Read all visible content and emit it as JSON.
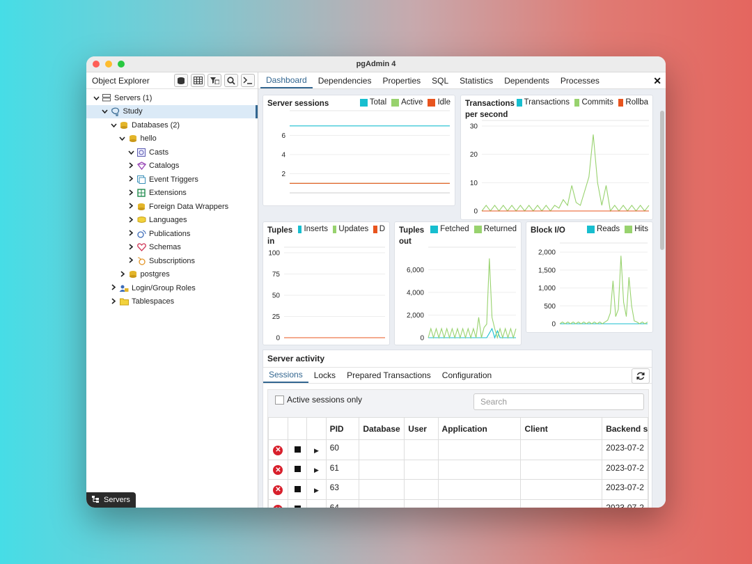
{
  "window": {
    "title": "pgAdmin 4",
    "traffic_colors": [
      "#fe5f57",
      "#febc2e",
      "#28c840"
    ]
  },
  "object_explorer": {
    "title": "Object Explorer",
    "toolbar": [
      "db-query-icon",
      "table-icon",
      "filter-table-icon",
      "search-icon",
      "terminal-icon"
    ],
    "tree": [
      {
        "label": "Servers (1)",
        "depth": 0,
        "arrow": "down",
        "icon": "servers-icon",
        "selected": false
      },
      {
        "label": "Study",
        "depth": 1,
        "arrow": "down",
        "icon": "elephant-icon",
        "selected": true
      },
      {
        "label": "Databases (2)",
        "depth": 2,
        "arrow": "down",
        "icon": "databases-icon",
        "selected": false
      },
      {
        "label": "hello",
        "depth": 3,
        "arrow": "down",
        "icon": "database-icon",
        "selected": false
      },
      {
        "label": "Casts",
        "depth": 4,
        "arrow": "down",
        "icon": "casts-icon",
        "selected": false
      },
      {
        "label": "Catalogs",
        "depth": 4,
        "arrow": "right",
        "icon": "catalogs-icon",
        "selected": false
      },
      {
        "label": "Event Triggers",
        "depth": 4,
        "arrow": "right",
        "icon": "event-triggers-icon",
        "selected": false
      },
      {
        "label": "Extensions",
        "depth": 4,
        "arrow": "right",
        "icon": "extensions-icon",
        "selected": false
      },
      {
        "label": "Foreign Data Wrappers",
        "depth": 4,
        "arrow": "right",
        "icon": "foreign-data-wrappers-icon",
        "selected": false
      },
      {
        "label": "Languages",
        "depth": 4,
        "arrow": "right",
        "icon": "languages-icon",
        "selected": false
      },
      {
        "label": "Publications",
        "depth": 4,
        "arrow": "right",
        "icon": "publications-icon",
        "selected": false
      },
      {
        "label": "Schemas",
        "depth": 4,
        "arrow": "right",
        "icon": "schemas-icon",
        "selected": false
      },
      {
        "label": "Subscriptions",
        "depth": 4,
        "arrow": "right",
        "icon": "subscriptions-icon",
        "selected": false
      },
      {
        "label": "postgres",
        "depth": 3,
        "arrow": "right",
        "icon": "database-icon",
        "selected": false
      },
      {
        "label": "Login/Group Roles",
        "depth": 2,
        "arrow": "right",
        "icon": "roles-icon",
        "selected": false
      },
      {
        "label": "Tablespaces",
        "depth": 2,
        "arrow": "right",
        "icon": "tablespaces-icon",
        "selected": false
      }
    ],
    "status_label": "Servers"
  },
  "tabs": [
    "Dashboard",
    "Dependencies",
    "Properties",
    "SQL",
    "Statistics",
    "Dependents",
    "Processes"
  ],
  "active_tab": "Dashboard",
  "colors": {
    "cyan": "#17becf",
    "green": "#98d26e",
    "orange": "#e8541e",
    "accent": "#326690"
  },
  "chart_data": [
    {
      "type": "line",
      "title": "Server sessions",
      "series": [
        {
          "name": "Total",
          "color": "#17becf",
          "values": [
            7,
            7,
            7,
            7,
            7,
            7,
            7,
            7,
            7,
            7,
            7,
            7,
            7,
            7,
            7,
            7,
            7,
            7,
            7,
            7,
            7,
            7,
            7,
            7,
            7,
            7,
            7,
            7,
            7,
            7
          ]
        },
        {
          "name": "Active",
          "color": "#98d26e",
          "values": [
            1,
            1,
            1,
            1,
            1,
            1,
            1,
            1,
            1,
            1,
            1,
            1,
            1,
            1,
            1,
            1,
            1,
            1,
            1,
            1,
            1,
            1,
            1,
            1,
            1,
            1,
            1,
            1,
            1,
            1
          ]
        },
        {
          "name": "Idle",
          "color": "#e8541e",
          "values": [
            1,
            1,
            1,
            1,
            1,
            1,
            1,
            1,
            1,
            1,
            1,
            1,
            1,
            1,
            1,
            1,
            1,
            1,
            1,
            1,
            1,
            1,
            1,
            1,
            1,
            1,
            1,
            1,
            1,
            1
          ]
        }
      ],
      "yticks": [
        "2",
        "4",
        "6"
      ],
      "ylim": [
        0,
        8
      ]
    },
    {
      "type": "line",
      "title": "Transactions per second",
      "title_lines": [
        "Transactions",
        "per second"
      ],
      "series": [
        {
          "name": "Transactions",
          "color": "#17becf",
          "values": []
        },
        {
          "name": "Commits",
          "color": "#98d26e",
          "values": [
            0,
            2,
            0,
            2,
            0,
            2,
            0,
            2,
            0,
            2,
            0,
            2,
            0,
            2,
            0,
            2,
            0,
            2,
            1,
            4,
            2,
            9,
            3,
            2,
            7,
            12,
            27,
            10,
            2,
            9,
            0,
            2,
            0,
            2,
            0,
            2,
            0,
            2,
            0,
            2
          ]
        },
        {
          "name": "Rollba",
          "color": "#e8541e",
          "values": [
            0,
            0,
            0,
            0,
            0,
            0,
            0,
            0,
            0,
            0,
            0,
            0,
            0,
            0,
            0,
            0,
            0,
            0,
            0,
            0,
            0,
            0,
            0,
            0,
            0,
            0,
            0,
            0,
            0,
            0,
            0,
            0,
            0,
            0,
            0,
            0,
            0,
            0,
            0,
            0
          ]
        }
      ],
      "yticks": [
        "0",
        "10",
        "20",
        "30"
      ],
      "ylim": [
        0,
        30
      ]
    },
    {
      "type": "line",
      "title": "Tuples in",
      "title_lines": [
        "Tuples",
        "in"
      ],
      "series": [
        {
          "name": "Inserts",
          "color": "#17becf",
          "values": []
        },
        {
          "name": "Updates",
          "color": "#98d26e",
          "values": []
        },
        {
          "name": "D",
          "color": "#e8541e",
          "values": [
            0,
            0,
            0,
            0,
            0,
            0,
            0,
            0,
            0,
            0
          ]
        }
      ],
      "yticks": [
        "0",
        "25",
        "50",
        "75",
        "100"
      ],
      "ylim": [
        0,
        100
      ]
    },
    {
      "type": "line",
      "title": "Tuples out",
      "title_lines": [
        "Tuples",
        "out"
      ],
      "series": [
        {
          "name": "Fetched",
          "color": "#17becf",
          "values": [
            0,
            0,
            0,
            0,
            0,
            0,
            0,
            0,
            0,
            0,
            0,
            0,
            0,
            0,
            0,
            0,
            0,
            0,
            0,
            0,
            0,
            0,
            0,
            400,
            800,
            0,
            600,
            0,
            0,
            0,
            0,
            0,
            0,
            0
          ]
        },
        {
          "name": "Returned",
          "color": "#98d26e",
          "values": [
            0,
            800,
            0,
            800,
            0,
            800,
            0,
            800,
            0,
            800,
            0,
            800,
            0,
            800,
            0,
            800,
            0,
            800,
            0,
            1800,
            0,
            900,
            1200,
            7000,
            1800,
            800,
            0,
            800,
            0,
            800,
            0,
            800,
            0,
            800
          ]
        }
      ],
      "yticks": [
        "0",
        "2,000",
        "4,000",
        "6,000"
      ],
      "ylim": [
        0,
        7500
      ]
    },
    {
      "type": "line",
      "title": "Block I/O",
      "series": [
        {
          "name": "Reads",
          "color": "#17becf",
          "values": [
            0,
            0,
            0,
            0,
            0,
            0,
            0,
            0,
            0,
            0,
            0,
            0,
            0,
            0,
            0,
            0,
            0,
            0,
            0,
            0,
            0,
            0,
            0,
            0,
            0,
            0,
            0,
            0,
            0,
            0,
            0,
            0,
            0,
            0
          ]
        },
        {
          "name": "Hits",
          "color": "#98d26e",
          "values": [
            0,
            50,
            0,
            50,
            0,
            50,
            0,
            50,
            0,
            50,
            0,
            50,
            0,
            50,
            0,
            50,
            0,
            50,
            100,
            300,
            1200,
            200,
            400,
            1900,
            600,
            200,
            1300,
            500,
            80,
            50,
            0,
            50,
            0,
            50
          ]
        }
      ],
      "yticks": [
        "0",
        "500",
        "1,000",
        "1,500",
        "2,000"
      ],
      "ylim": [
        0,
        2100
      ]
    }
  ],
  "activity": {
    "title": "Server activity",
    "tabs": [
      "Sessions",
      "Locks",
      "Prepared Transactions",
      "Configuration"
    ],
    "active_tab": "Sessions",
    "checkbox_label": "Active sessions only",
    "search_placeholder": "Search",
    "columns": [
      "",
      "",
      "",
      "PID",
      "Database",
      "User",
      "Application",
      "Client",
      "Backend s"
    ],
    "rows": [
      {
        "pid": "60",
        "backend": "2023-07-2"
      },
      {
        "pid": "61",
        "backend": "2023-07-2"
      },
      {
        "pid": "63",
        "backend": "2023-07-2"
      },
      {
        "pid": "64",
        "backend": "2023-07-2"
      }
    ]
  }
}
